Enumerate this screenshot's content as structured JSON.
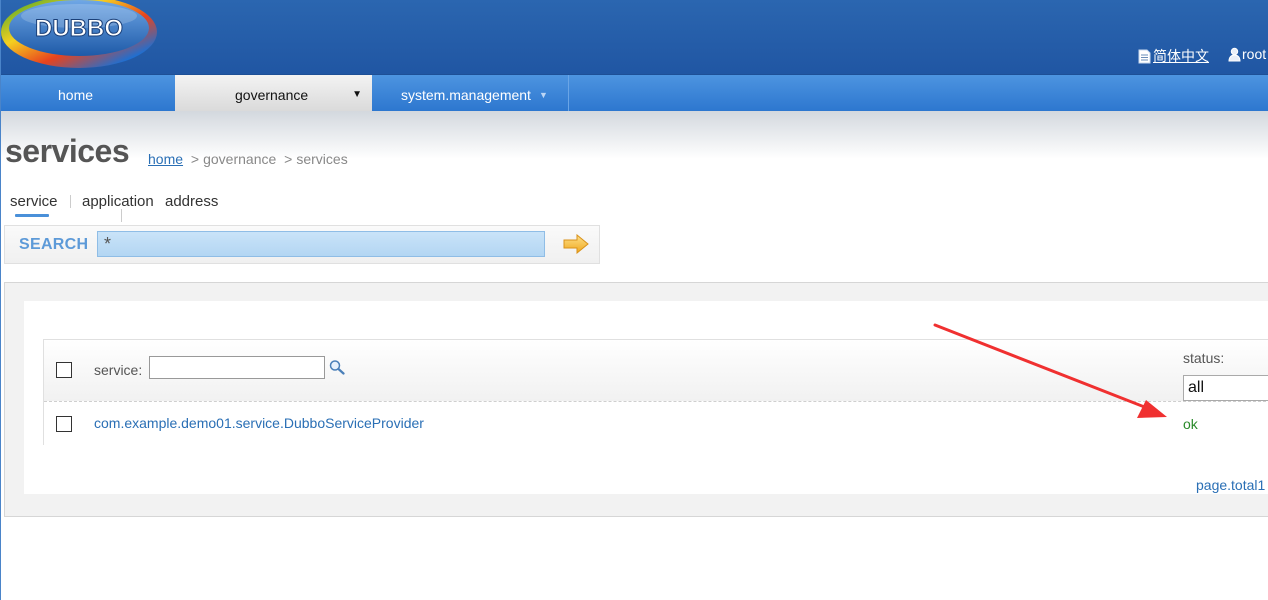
{
  "header": {
    "logo_text": "DUBBO",
    "language_link": "简体中文",
    "user_link": "root"
  },
  "nav": {
    "items": [
      {
        "label": "home"
      },
      {
        "label": "governance",
        "active": true
      },
      {
        "label": "system.management"
      }
    ]
  },
  "page": {
    "title": "services",
    "breadcrumb": {
      "home": "home",
      "separator": ">",
      "governance": "governance",
      "current": "services"
    }
  },
  "subtabs": {
    "items": [
      {
        "label": "service",
        "active": true
      },
      {
        "label": "application"
      },
      {
        "label": "address"
      }
    ]
  },
  "search": {
    "label": "SEARCH",
    "value": "*"
  },
  "table": {
    "service_filter_label": "service:",
    "service_filter_value": "",
    "status_label": "status:",
    "status_selected": "all",
    "rows": [
      {
        "service": "com.example.demo01.service.DubboServiceProvider",
        "status": "ok"
      }
    ],
    "pager_text": "page.total1"
  },
  "colors": {
    "header_bg": "#2056a3",
    "nav_bg": "#2d77cf",
    "link": "#2a6fb5",
    "status_ok": "#2a8a2a",
    "annotation_arrow": "#f03030"
  }
}
